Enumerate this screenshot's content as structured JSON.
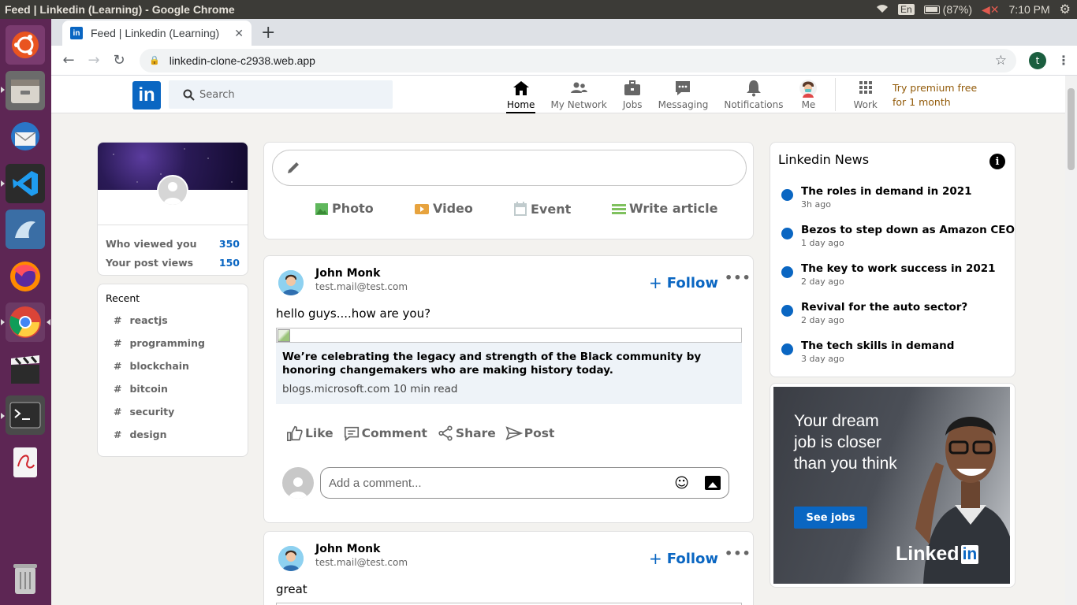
{
  "os": {
    "window_title": "Feed | Linkedin (Learning) - Google Chrome",
    "lang": "En",
    "battery": "(87%)",
    "time": "7:10 PM"
  },
  "browser": {
    "tab_title": "Feed | Linkedin (Learning)",
    "url": "linkedin-clone-c2938.web.app",
    "profile_initial": "t"
  },
  "header": {
    "logo": "in",
    "search_placeholder": "Search",
    "nav": [
      {
        "label": "Home",
        "icon": "home-icon"
      },
      {
        "label": "My Network",
        "icon": "network-icon"
      },
      {
        "label": "Jobs",
        "icon": "briefcase-icon"
      },
      {
        "label": "Messaging",
        "icon": "message-icon"
      },
      {
        "label": "Notifications",
        "icon": "bell-icon"
      },
      {
        "label": "Me",
        "icon": "avatar-icon"
      },
      {
        "label": "Work",
        "icon": "grid-icon"
      }
    ],
    "premium_line1": "Try premium free",
    "premium_line2": "for 1 month"
  },
  "sidebar": {
    "stats": [
      {
        "label": "Who viewed you",
        "value": "350"
      },
      {
        "label": "Your post views",
        "value": "150"
      }
    ],
    "recent_title": "Recent",
    "recent": [
      "reactjs",
      "programming",
      "blockchain",
      "bitcoin",
      "security",
      "design"
    ]
  },
  "composer": {
    "options": [
      {
        "label": "Photo",
        "color": "#70b5f9"
      },
      {
        "label": "Video",
        "color": "#e7a33e"
      },
      {
        "label": "Event",
        "color": "#c0cbcd"
      },
      {
        "label": "Write article",
        "color": "#7fc15e"
      }
    ]
  },
  "posts": [
    {
      "name": "John Monk",
      "email": "test.mail@test.com",
      "follow": "Follow",
      "text": "hello guys....how are you?",
      "link_title": "We’re celebrating the legacy and strength of the Black community by honoring changemakers who are making history today.",
      "link_source": "blogs.microsoft.com 10 min read",
      "actions": [
        "Like",
        "Comment",
        "Share",
        "Post"
      ],
      "comment_placeholder": "Add a comment..."
    },
    {
      "name": "John Monk",
      "email": "test.mail@test.com",
      "follow": "Follow",
      "text": "great"
    }
  ],
  "news": {
    "title": "Linkedin News",
    "items": [
      {
        "headline": "The roles in demand in 2021",
        "time": "3h ago"
      },
      {
        "headline": "Bezos to step down as Amazon CEO",
        "time": "1 day ago"
      },
      {
        "headline": "The key to work success in 2021",
        "time": "2 day ago"
      },
      {
        "headline": "Revival for the auto sector?",
        "time": "2 day ago"
      },
      {
        "headline": "The tech skills in demand",
        "time": "3 day ago"
      }
    ]
  },
  "ad": {
    "headline": "Your dream job is closer than you think",
    "button": "See jobs",
    "brand_left": "Linked",
    "brand_right": "in"
  }
}
